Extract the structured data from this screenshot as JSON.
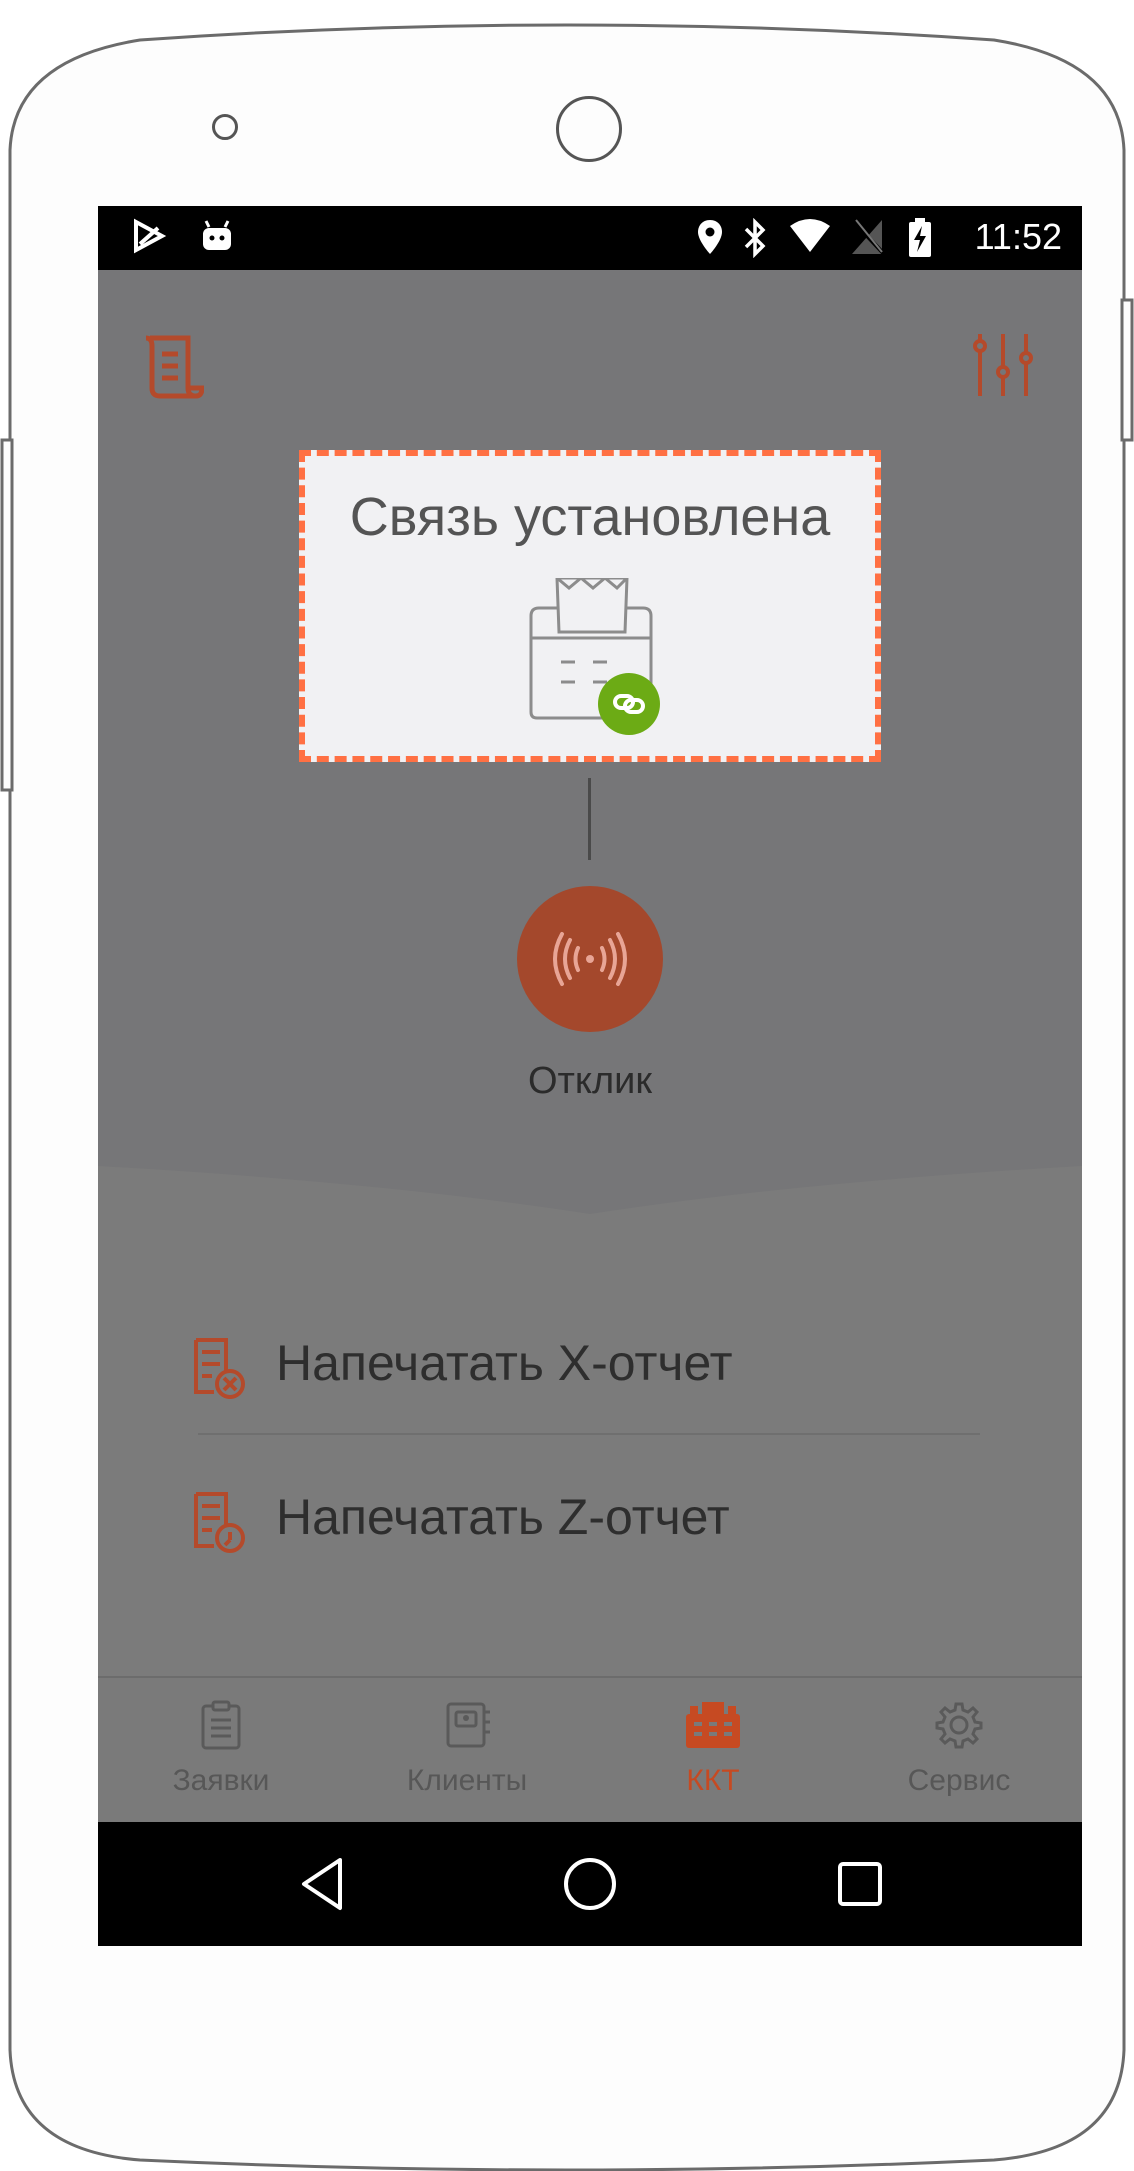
{
  "status_bar": {
    "time": "11:52"
  },
  "header": {
    "left_icon": "receipt-scroll-icon",
    "right_icon": "sliders-icon"
  },
  "dialog": {
    "title": "Связь установлена",
    "icon": "printer-link-icon",
    "badge_color": "#6cab15"
  },
  "response_button": {
    "label": "Отклик",
    "icon": "radio-waves-icon"
  },
  "menu": {
    "items": [
      {
        "label": "Напечатать X-отчет",
        "icon": "report-x-icon"
      },
      {
        "label": "Напечатать Z-отчет",
        "icon": "report-z-icon"
      }
    ]
  },
  "bottom_nav": {
    "items": [
      {
        "label": "Заявки",
        "icon": "clipboard-icon",
        "active": false
      },
      {
        "label": "Клиенты",
        "icon": "contacts-book-icon",
        "active": false
      },
      {
        "label": "ККТ",
        "icon": "cash-register-icon",
        "active": true
      },
      {
        "label": "Сервис",
        "icon": "gear-icon",
        "active": false
      }
    ]
  },
  "colors": {
    "accent": "#c64a22",
    "dialog_border": "#ff7043",
    "overlay": "#7b7b7b"
  }
}
